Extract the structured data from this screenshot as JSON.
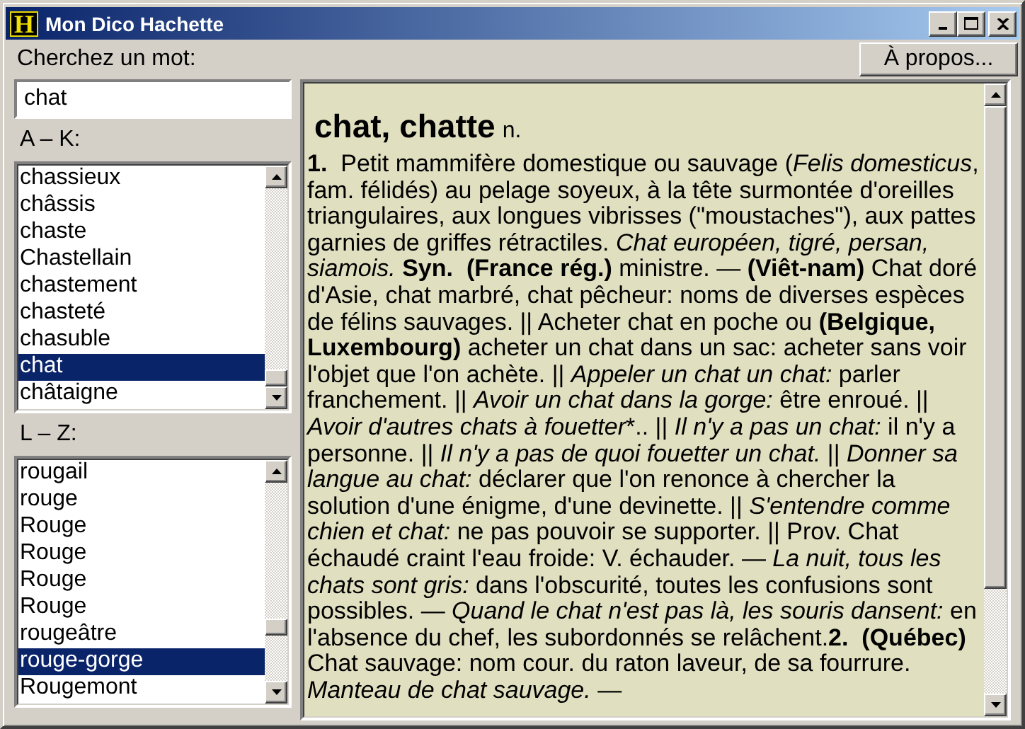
{
  "window": {
    "title": "Mon Dico Hachette",
    "icon": "H"
  },
  "search": {
    "label": "Cherchez un mot:",
    "value": "chat"
  },
  "about_button": "À propos...",
  "lists": [
    {
      "label": "A – K:",
      "items": [
        {
          "text": "chassieux",
          "selected": false
        },
        {
          "text": "châssis",
          "selected": false
        },
        {
          "text": "chaste",
          "selected": false
        },
        {
          "text": "Chastellain",
          "selected": false
        },
        {
          "text": "chastement",
          "selected": false
        },
        {
          "text": "chasteté",
          "selected": false
        },
        {
          "text": "chasuble",
          "selected": false
        },
        {
          "text": "chat",
          "selected": true
        },
        {
          "text": "châtaigne",
          "selected": false
        }
      ]
    },
    {
      "label": "L – Z:",
      "items": [
        {
          "text": "rougail",
          "selected": false
        },
        {
          "text": "rouge",
          "selected": false
        },
        {
          "text": "Rouge",
          "selected": false
        },
        {
          "text": "Rouge",
          "selected": false
        },
        {
          "text": "Rouge",
          "selected": false
        },
        {
          "text": "Rouge",
          "selected": false
        },
        {
          "text": "rougeâtre",
          "selected": false
        },
        {
          "text": "rouge-gorge",
          "selected": true
        },
        {
          "text": "Rougemont",
          "selected": false
        }
      ]
    }
  ],
  "definition": {
    "headword": "chat, chatte",
    "pos": "n.",
    "body": [
      "**1.**  Petit mammifère domestique ou sauvage (*Felis domesticus*, fam. félidés) au pelage soyeux, à la tête surmontée d'oreilles triangulaires, aux longues vibrisses (\"moustaches\"), aux pattes garnies de griffes rétractiles. *Chat européen, tigré, persan, siamois.* **Syn.  (France rég.)** ministre. — **(Viêt-nam)** Chat doré d'Asie, chat marbré, chat pêcheur: noms de diverses espèces de félins sauvages. || Acheter chat en poche ou **(Belgique, Luxembourg)** acheter un chat dans un sac: acheter sans voir l'objet que l'on achète. || *Appeler un chat un chat:* parler franchement. || *Avoir un chat dans la gorge:* être enroué. || *Avoir d'autres chats à fouetter*",
      "*.",
      ". || *Il n'y a pas un chat:* il n'y a personne. || *Il n'y a pas de quoi fouetter un chat.* || *Donner sa langue au chat:* déclarer que l'on renonce à chercher la solution d'une énigme, d'une devinette. || *S'entendre comme chien et chat:* ne pas pouvoir se supporter. || Prov. Chat échaudé craint l'eau froide: V. échauder. — *La nuit, tous les chats sont gris:* dans l'obscurité, toutes les confusions sont possibles. — *Quand le chat n'est pas là, les souris dansent:* en l'absence du chef, les subordonnés se relâchent.**2.  (Québec)** Chat sauvage: nom cour. du raton laveur, de sa fourrure. *Manteau de chat sauvage.* —"
    ]
  }
}
